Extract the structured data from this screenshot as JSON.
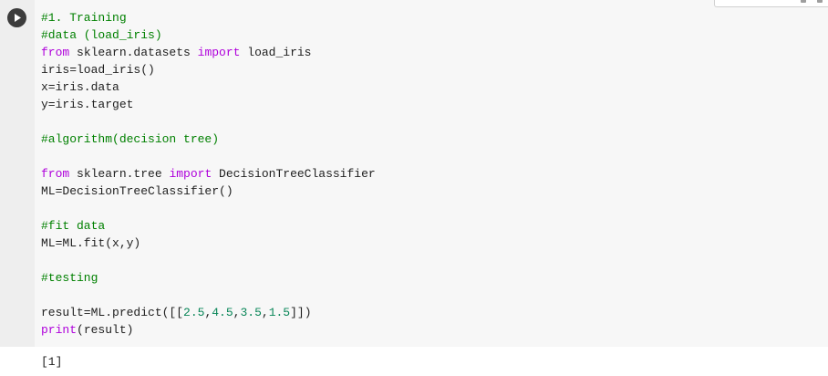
{
  "cell": {
    "run_button_label": "Run cell",
    "code_lines": [
      [
        {
          "t": "#1. Training",
          "k": "comment"
        }
      ],
      [
        {
          "t": "#data (load_iris)",
          "k": "comment"
        }
      ],
      [
        {
          "t": "from",
          "k": "keyword"
        },
        {
          "t": " sklearn.datasets ",
          "k": "text"
        },
        {
          "t": "import",
          "k": "keyword"
        },
        {
          "t": " load_iris",
          "k": "text"
        }
      ],
      [
        {
          "t": "iris=load_iris()",
          "k": "text"
        }
      ],
      [
        {
          "t": "x=iris.data",
          "k": "text"
        }
      ],
      [
        {
          "t": "y=iris.target",
          "k": "text"
        }
      ],
      [],
      [
        {
          "t": "#algorithm(decision tree)",
          "k": "comment"
        }
      ],
      [],
      [
        {
          "t": "from",
          "k": "keyword"
        },
        {
          "t": " sklearn.tree ",
          "k": "text"
        },
        {
          "t": "import",
          "k": "keyword"
        },
        {
          "t": " DecisionTreeClassifier",
          "k": "text"
        }
      ],
      [
        {
          "t": "ML=DecisionTreeClassifier()",
          "k": "text"
        }
      ],
      [],
      [
        {
          "t": "#fit data",
          "k": "comment"
        }
      ],
      [
        {
          "t": "ML=ML.fit(x,y)",
          "k": "text"
        }
      ],
      [],
      [
        {
          "t": "#testing",
          "k": "comment"
        }
      ],
      [],
      [
        {
          "t": "result=ML.predict([[",
          "k": "text"
        },
        {
          "t": "2.5",
          "k": "number"
        },
        {
          "t": ",",
          "k": "text"
        },
        {
          "t": "4.5",
          "k": "number"
        },
        {
          "t": ",",
          "k": "text"
        },
        {
          "t": "3.5",
          "k": "number"
        },
        {
          "t": ",",
          "k": "text"
        },
        {
          "t": "1.5",
          "k": "number"
        },
        {
          "t": "]])",
          "k": "text"
        }
      ],
      [
        {
          "t": "print",
          "k": "keyword"
        },
        {
          "t": "(result)",
          "k": "text"
        }
      ]
    ]
  },
  "output": {
    "text": "[1]"
  },
  "colors": {
    "comment": "#008000",
    "keyword": "#af00db",
    "number": "#098658",
    "text": "#212121",
    "gutter": "#eeeeee",
    "editor_bg": "#f7f7f7"
  },
  "icons": {
    "run": "play-circle-icon"
  }
}
